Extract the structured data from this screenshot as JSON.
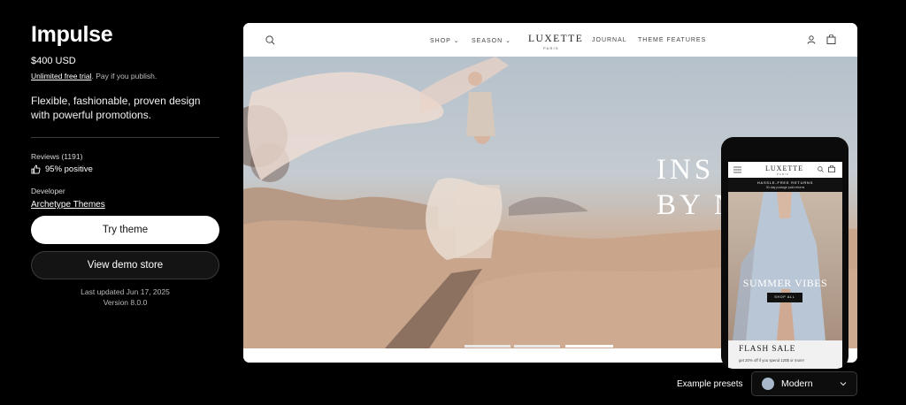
{
  "theme": {
    "name": "Impulse",
    "price": "$400 USD",
    "trial_link": "Unlimited free trial",
    "trial_suffix": ". Pay if you publish.",
    "description": "Flexible, fashionable, proven design with powerful promotions.",
    "reviews_label": "Reviews (1191)",
    "positive": "95% positive",
    "developer_label": "Developer",
    "developer_name": "Archetype Themes",
    "try_button": "Try theme",
    "demo_button": "View demo store",
    "last_updated": "Last updated Jun 17, 2025",
    "version": "Version 8.0.0"
  },
  "preview": {
    "nav": {
      "shop": "SHOP",
      "season": "SEASON",
      "logo": "LUXETTE",
      "logo_sub": "PARIS",
      "journal": "JOURNAL",
      "features": "THEME FEATURES"
    },
    "hero_line1": "INS",
    "hero_line2": "BY NA",
    "mobile": {
      "logo": "LUXETTE",
      "logo_sub": "PARIS",
      "banner_line1": "HASSLE-FREE RETURNS",
      "banner_line2": "30-day postage paid returns",
      "title": "SUMMER VIBES",
      "button": "SHOP ALL",
      "flash_title": "FLASH SALE",
      "flash_sub": "get 20% off if you spend 120$ or more!"
    }
  },
  "presets": {
    "label": "Example presets",
    "selected": "Modern",
    "swatch_color": "#a9b7cb"
  }
}
